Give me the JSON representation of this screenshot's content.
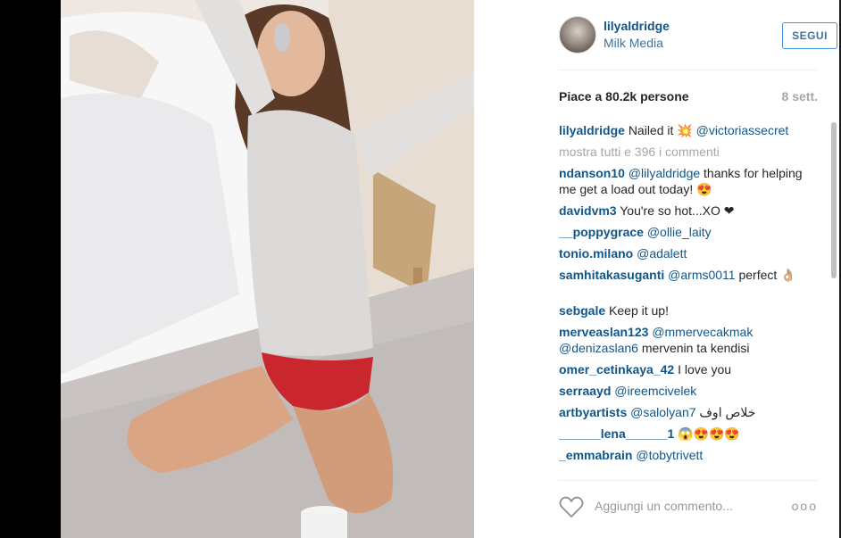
{
  "post": {
    "username": "lilyaldridge",
    "location": "Milk Media",
    "follow_label": "SEGUI",
    "likes_text": "Piace a 80.2k persone",
    "age": "8 sett.",
    "caption": {
      "user": "lilyaldridge",
      "text": "Nailed it ",
      "emoji": "💥",
      "mention": "@victoriassecret"
    },
    "show_all": "mostra tutti e 396 i commenti",
    "comments": [
      {
        "user": "ndanson10",
        "mention": "@lilyaldridge",
        "text": " thanks for helping me get a load out today! 😍"
      },
      {
        "user": "davidvm3",
        "mention": "",
        "text": " You're so hot...XO ❤"
      },
      {
        "user": "__poppygrace",
        "mention": "@ollie_laity",
        "text": ""
      },
      {
        "user": "tonio.milano",
        "mention": "@adalett",
        "text": ""
      },
      {
        "user": "samhitakasuganti",
        "mention": "@arms0011",
        "text": " perfect 👌🏼"
      },
      {
        "user": "sebgale",
        "mention": "",
        "text": " Keep it up!"
      },
      {
        "user": "merveaslan123",
        "mention": "@mmervecakmak @denizaslan6",
        "text": " mervenin ta kendisi"
      },
      {
        "user": "omer_cetinkaya_42",
        "mention": "",
        "text": " I love you"
      },
      {
        "user": "serraayd",
        "mention": "@ireemcivelek",
        "text": ""
      },
      {
        "user": "artbyartists",
        "mention": "@salolyan7",
        "text": " خلاص اوف"
      },
      {
        "user": "______lena______1",
        "mention": "",
        "text": " 😱😍😍😍"
      },
      {
        "user": "_emmabrain",
        "mention": "@tobytrivett",
        "text": ""
      }
    ],
    "add_comment_placeholder": "Aggiungi un commento...",
    "more_options": "ooo"
  },
  "colors": {
    "link": "#125688",
    "follow_border": "#4090db",
    "muted": "#a5a7aa"
  },
  "icons": {
    "like": "heart-outline-icon",
    "options": "ellipsis-icon"
  }
}
